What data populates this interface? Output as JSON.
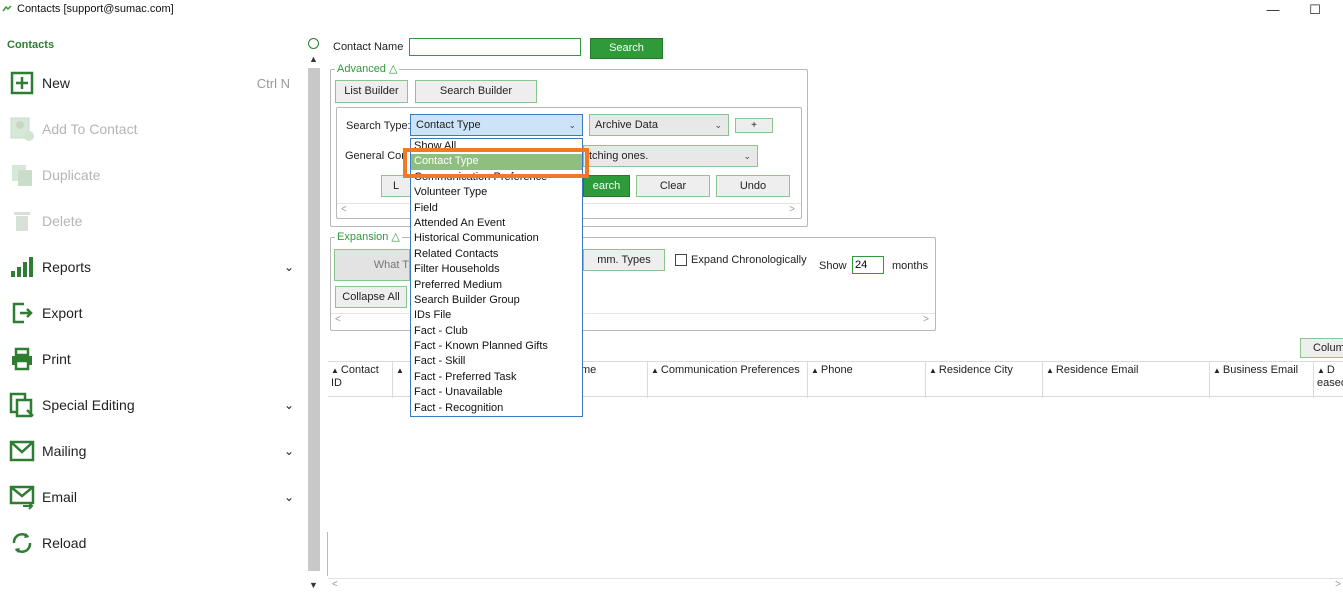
{
  "window": {
    "title": "Contacts   [support@sumac.com]",
    "minimize_symbol": "—",
    "maximize_symbol": "☐"
  },
  "sidebar": {
    "heading": "Contacts",
    "items": [
      {
        "label": "New",
        "shortcut": "Ctrl N",
        "icon": "plus-box-icon",
        "enabled": true
      },
      {
        "label": "Add To Contact",
        "icon": "add-contact-icon",
        "enabled": false
      },
      {
        "label": "Duplicate",
        "icon": "duplicate-icon",
        "enabled": false
      },
      {
        "label": "Delete",
        "icon": "trash-icon",
        "enabled": false
      },
      {
        "label": "Reports",
        "icon": "bar-chart-icon",
        "enabled": true,
        "expandable": true
      },
      {
        "label": "Export",
        "icon": "export-icon",
        "enabled": true
      },
      {
        "label": "Print",
        "icon": "printer-icon",
        "enabled": true
      },
      {
        "label": "Special Editing",
        "icon": "special-edit-icon",
        "enabled": true,
        "expandable": true
      },
      {
        "label": "Mailing",
        "icon": "mailing-icon",
        "enabled": true,
        "expandable": true
      },
      {
        "label": "Email",
        "icon": "email-icon",
        "enabled": true,
        "expandable": true
      },
      {
        "label": "Reload",
        "icon": "reload-icon",
        "enabled": true
      }
    ],
    "chevron": "⌄"
  },
  "search": {
    "contact_name_label": "Contact Name",
    "contact_name_value": "",
    "search_button": "Search"
  },
  "advanced": {
    "legend": "Advanced △",
    "list_builder": "List Builder",
    "search_builder": "Search Builder",
    "search_type_label": "Search Type:",
    "search_type_value": "Contact Type",
    "archive_value": "Archive Data",
    "plus_button": "+",
    "general_label": "General Cor",
    "match_value": "tching ones.",
    "l_button": "L",
    "search2_button": "earch",
    "clear_button": "Clear",
    "undo_button": "Undo"
  },
  "search_type_options": [
    "Show All",
    "Contact Type",
    "Communication Preference",
    "Volunteer Type",
    "Field",
    "Attended An Event",
    "Historical Communication",
    "Related Contacts",
    "Filter Households",
    "Preferred Medium",
    "Search Builder Group",
    "IDs File",
    "Fact - Club",
    "Fact - Known Planned Gifts",
    "Fact - Skill",
    "Fact - Preferred Task",
    "Fact - Unavailable",
    "Fact - Recognition"
  ],
  "selected_option_index": 1,
  "expansion": {
    "legend": "Expansion △",
    "what_button": "What T",
    "comm_types_button": "mm. Types",
    "expand_chrono_label": "Expand Chronologically",
    "show_label": "Show",
    "months_value": "24",
    "months_label": "months",
    "collapse_all": "Collapse All"
  },
  "columns_button": "Colum",
  "table": {
    "columns": [
      "Contact ID",
      "",
      "me",
      "Communication Preferences",
      "Phone",
      "Residence City",
      "Residence Email",
      "Business Email",
      "D eased"
    ]
  }
}
